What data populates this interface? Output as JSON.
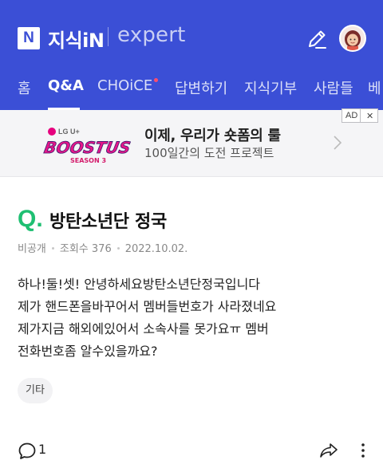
{
  "header": {
    "logo_letter": "N",
    "brand": "지식iN",
    "brand_secondary": "expert",
    "background_color": "#3b4fd6",
    "icons": [
      "pencil-icon",
      "avatar"
    ]
  },
  "tabs": [
    {
      "label": "홈",
      "active": false
    },
    {
      "label": "Q&A",
      "active": true
    },
    {
      "label": "CHOiCE",
      "active": false,
      "has_new_dot": true
    },
    {
      "label": "답변하기",
      "active": false
    },
    {
      "label": "지식기부",
      "active": false
    },
    {
      "label": "사람들",
      "active": false
    },
    {
      "label": "베",
      "active": false
    }
  ],
  "ad": {
    "badge": "AD",
    "close": "✕",
    "advertiser": "LG U+",
    "campaign_logo_text": "BOOSTUS",
    "campaign_logo_sub": "SEASON 3",
    "title": "이제, 우리가 숏폼의 룰",
    "subtitle": "100일간의 도전 프로젝트"
  },
  "question": {
    "mark": "Q.",
    "title": "방탄소년단 정국",
    "author": "비공개",
    "views": "조회수 376",
    "date": "2022.10.02.",
    "body_lines": [
      "하나!둘!셋! 안녕하세요방탄소년단정국입니다",
      "제가 핸드폰을바꾸어서 멤버들번호가 사라졌네요",
      "제가지금 해외에있어서 소속사를 못가요ㅠ 멤버",
      "전화번호좀 알수있을까요?"
    ],
    "tag": "기타",
    "accent_color": "#1fbf72"
  },
  "footer": {
    "comment_count": "1",
    "icons": [
      "comment-icon",
      "share-icon",
      "more-icon"
    ]
  }
}
